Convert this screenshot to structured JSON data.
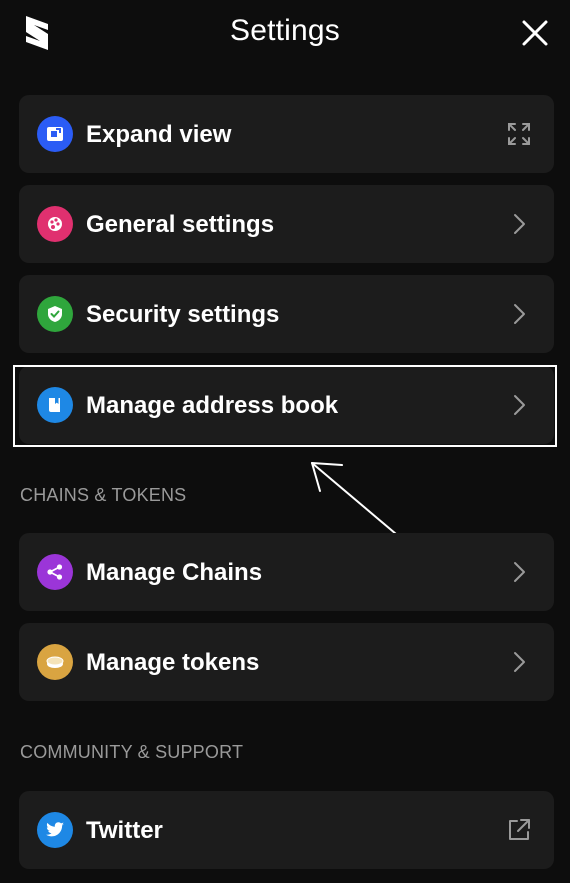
{
  "header": {
    "title": "Settings",
    "logo_icon": "brand-s-logo",
    "close_icon": "close-icon"
  },
  "items": [
    {
      "label": "Expand view",
      "icon": "expand-view-icon",
      "icon_color": "#2b5cf5",
      "trailing": "expand-arrows-icon"
    },
    {
      "label": "General settings",
      "icon": "palette-icon",
      "icon_color": "#e0306f",
      "trailing": "chevron-right-icon"
    },
    {
      "label": "Security settings",
      "icon": "shield-check-icon",
      "icon_color": "#2fa63c",
      "trailing": "chevron-right-icon"
    },
    {
      "label": "Manage address book",
      "icon": "book-icon",
      "icon_color": "#1e88e5",
      "trailing": "chevron-right-icon"
    }
  ],
  "sections": {
    "chains_tokens": {
      "title": "CHAINS & TOKENS",
      "items": [
        {
          "label": "Manage Chains",
          "icon": "share-nodes-icon",
          "icon_color": "#9b35d8",
          "trailing": "chevron-right-icon"
        },
        {
          "label": "Manage tokens",
          "icon": "coin-icon",
          "icon_color": "#d9a441",
          "trailing": "chevron-right-icon"
        }
      ]
    },
    "community": {
      "title": "COMMUNITY & SUPPORT",
      "items": [
        {
          "label": "Twitter",
          "icon": "twitter-bird-icon",
          "icon_color": "#1e88e5",
          "trailing": "external-link-icon"
        }
      ]
    }
  },
  "colors": {
    "background": "#0d0d0d",
    "card": "#1c1c1c",
    "section_text": "#9a9a9a",
    "highlight_border": "#ffffff"
  }
}
